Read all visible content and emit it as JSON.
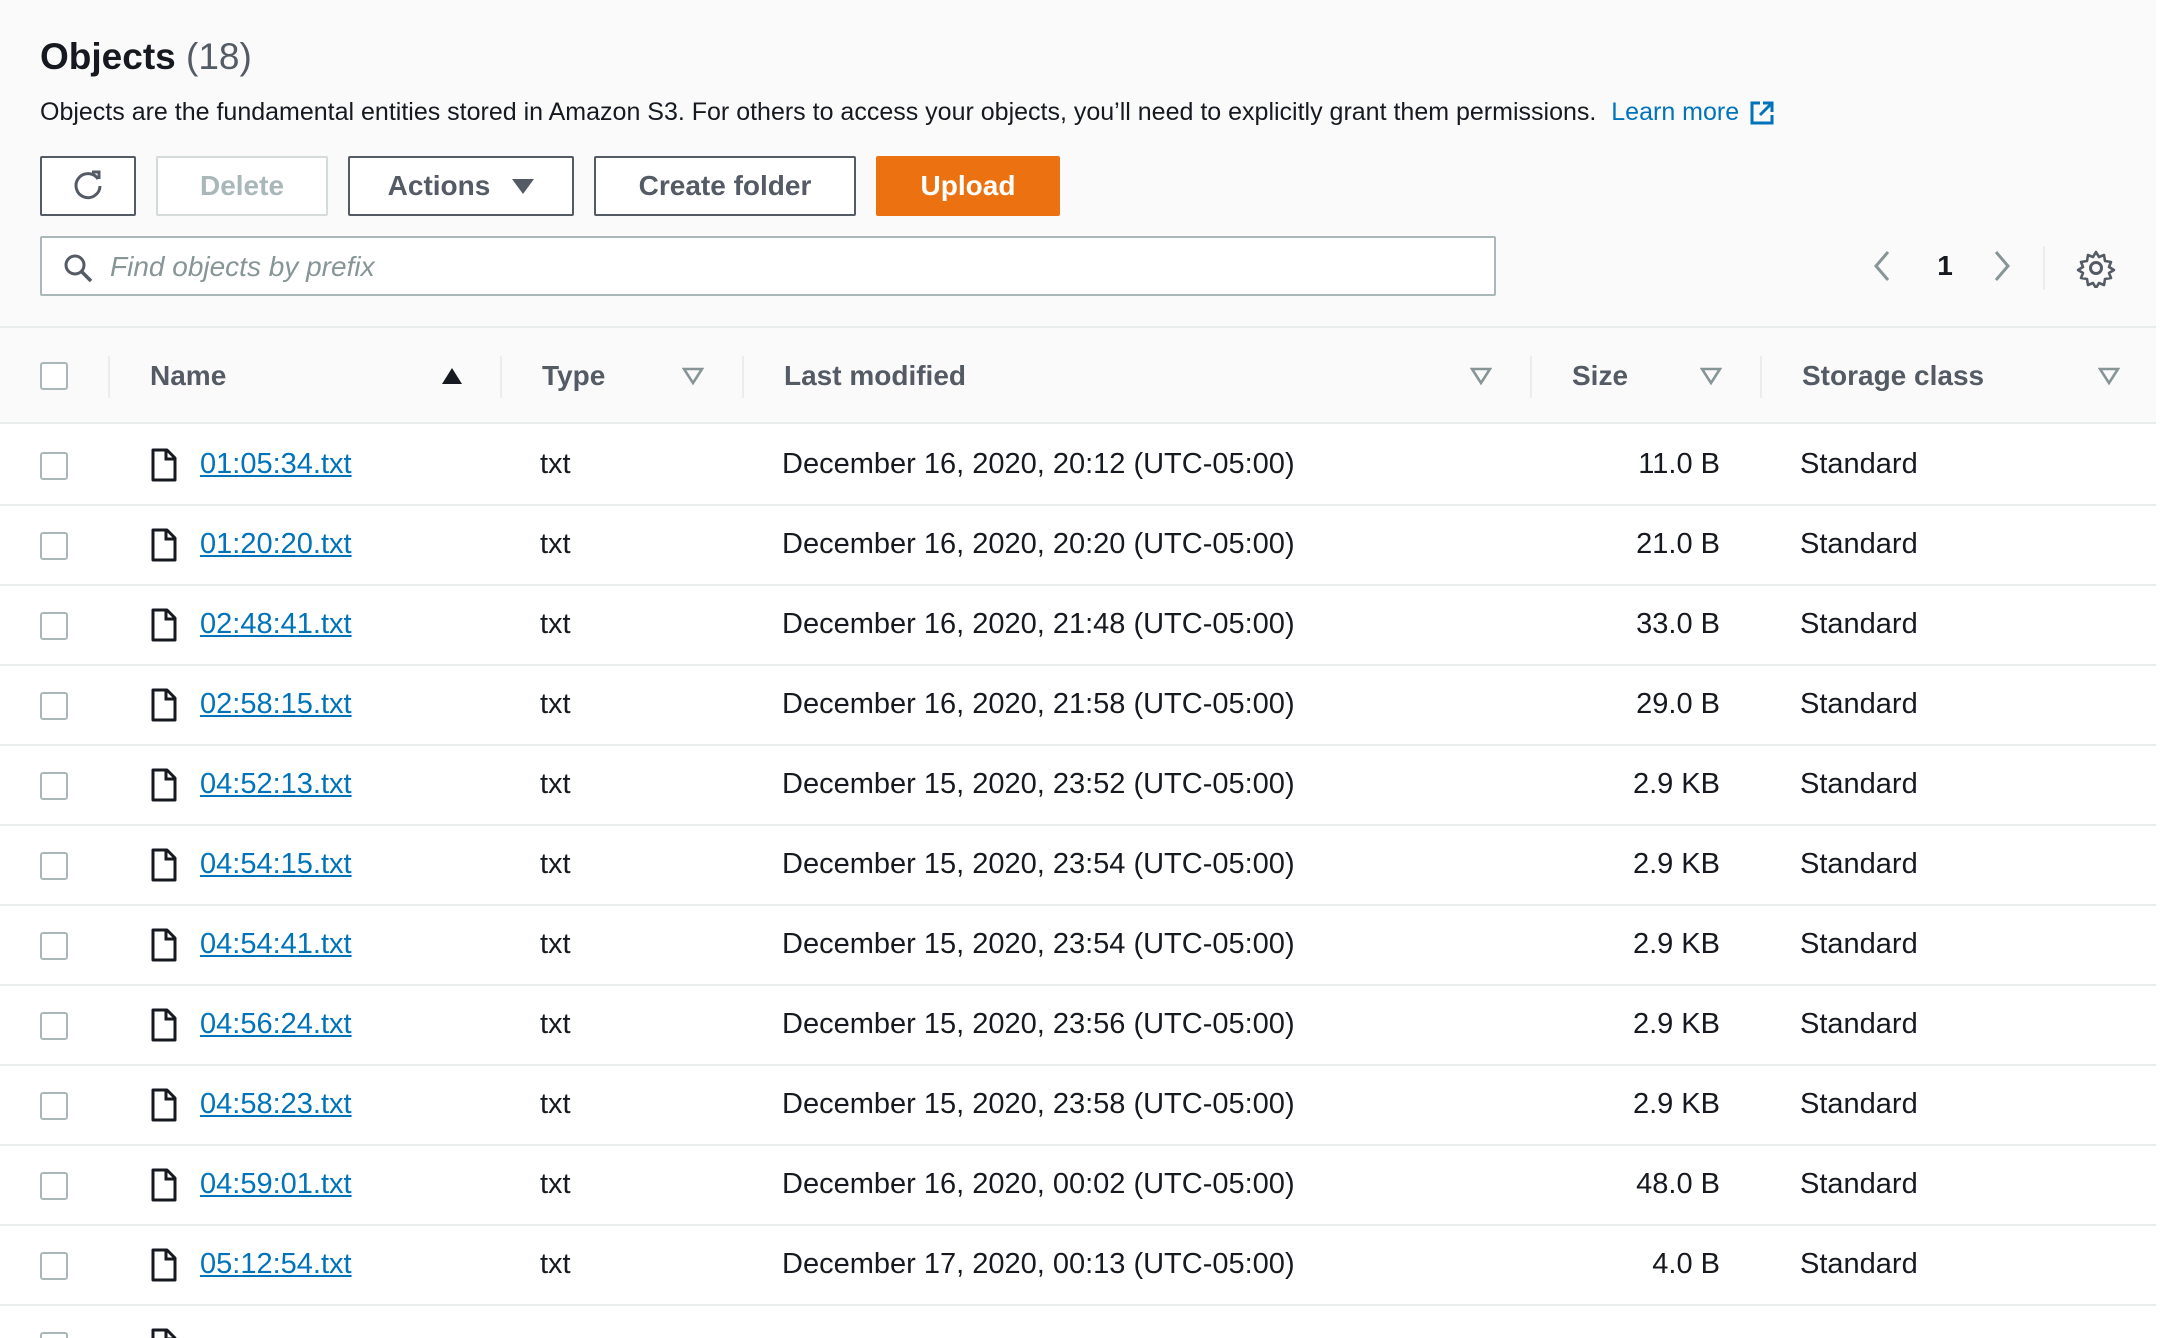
{
  "header": {
    "title": "Objects",
    "count": "(18)",
    "description": "Objects are the fundamental entities stored in Amazon S3. For others to access your objects, you’ll need to explicitly grant them permissions.",
    "learn_more": "Learn more"
  },
  "toolbar": {
    "delete_label": "Delete",
    "actions_label": "Actions",
    "create_folder_label": "Create folder",
    "upload_label": "Upload"
  },
  "search": {
    "placeholder": "Find objects by prefix",
    "value": ""
  },
  "pagination": {
    "current_page": "1"
  },
  "table": {
    "columns": {
      "name": "Name",
      "type": "Type",
      "last_modified": "Last modified",
      "size": "Size",
      "storage_class": "Storage class"
    },
    "rows": [
      {
        "name": "01:05:34.txt",
        "type": "txt",
        "last_modified": "December 16, 2020, 20:12 (UTC-05:00)",
        "size": "11.0 B",
        "storage_class": "Standard"
      },
      {
        "name": "01:20:20.txt",
        "type": "txt",
        "last_modified": "December 16, 2020, 20:20 (UTC-05:00)",
        "size": "21.0 B",
        "storage_class": "Standard"
      },
      {
        "name": "02:48:41.txt",
        "type": "txt",
        "last_modified": "December 16, 2020, 21:48 (UTC-05:00)",
        "size": "33.0 B",
        "storage_class": "Standard"
      },
      {
        "name": "02:58:15.txt",
        "type": "txt",
        "last_modified": "December 16, 2020, 21:58 (UTC-05:00)",
        "size": "29.0 B",
        "storage_class": "Standard"
      },
      {
        "name": "04:52:13.txt",
        "type": "txt",
        "last_modified": "December 15, 2020, 23:52 (UTC-05:00)",
        "size": "2.9 KB",
        "storage_class": "Standard"
      },
      {
        "name": "04:54:15.txt",
        "type": "txt",
        "last_modified": "December 15, 2020, 23:54 (UTC-05:00)",
        "size": "2.9 KB",
        "storage_class": "Standard"
      },
      {
        "name": "04:54:41.txt",
        "type": "txt",
        "last_modified": "December 15, 2020, 23:54 (UTC-05:00)",
        "size": "2.9 KB",
        "storage_class": "Standard"
      },
      {
        "name": "04:56:24.txt",
        "type": "txt",
        "last_modified": "December 15, 2020, 23:56 (UTC-05:00)",
        "size": "2.9 KB",
        "storage_class": "Standard"
      },
      {
        "name": "04:58:23.txt",
        "type": "txt",
        "last_modified": "December 15, 2020, 23:58 (UTC-05:00)",
        "size": "2.9 KB",
        "storage_class": "Standard"
      },
      {
        "name": "04:59:01.txt",
        "type": "txt",
        "last_modified": "December 16, 2020, 00:02 (UTC-05:00)",
        "size": "48.0 B",
        "storage_class": "Standard"
      },
      {
        "name": "05:12:54.txt",
        "type": "txt",
        "last_modified": "December 17, 2020, 00:13 (UTC-05:00)",
        "size": "4.0 B",
        "storage_class": "Standard"
      }
    ]
  },
  "colors": {
    "link": "#0073bb",
    "primary_button": "#ec7211",
    "text": "#16191f",
    "muted": "#545b64",
    "border": "#eaeded"
  },
  "icons": [
    "refresh-icon",
    "caret-down-icon",
    "external-link-icon",
    "search-icon",
    "chevron-left-icon",
    "chevron-right-icon",
    "gear-icon",
    "sort-ascending-icon",
    "sort-filter-icon",
    "file-icon"
  ]
}
